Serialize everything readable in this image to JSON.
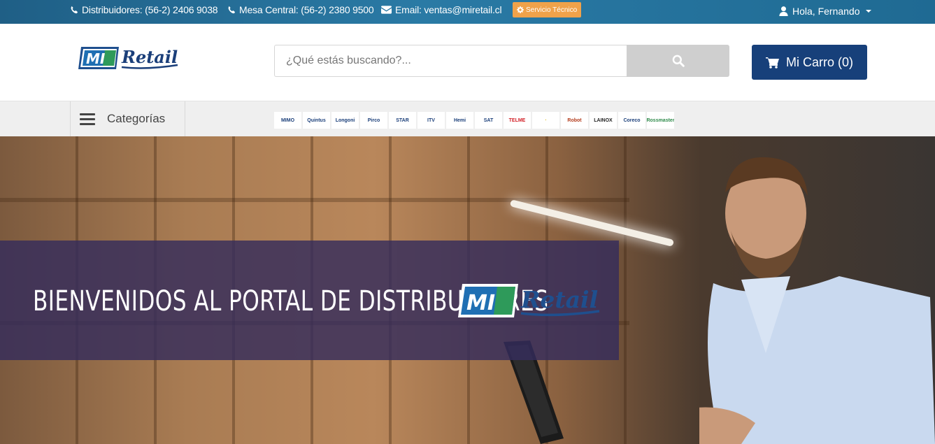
{
  "topbar": {
    "distribuidores": "Distribuidores: (56-2) 2406 9038",
    "mesa_central": "Mesa Central: (56-2) 2380 9500",
    "email": "Email: ventas@miretail.cl",
    "servicio_tecnico": "Servicio Técnico",
    "user_greeting": "Hola, Fernando"
  },
  "header": {
    "logo_text_mi": "MI",
    "logo_text_retail": "Retail",
    "search_placeholder": "¿Qué estás buscando?...",
    "cart_label": "Mi Carro (0)"
  },
  "nav": {
    "categories_label": "Categorías",
    "brands": [
      "MIMO",
      "Quintus",
      "Longoni",
      "Pirco",
      "STAR",
      "ITV",
      "Hemi",
      "SAT",
      "TELME",
      "·",
      "Robot",
      "LAINOX",
      "Coreco",
      "Rossmaster"
    ]
  },
  "hero": {
    "welcome_text": "BIENVENIDOS AL PORTAL DE DISTRIBUIDORES",
    "logo_text_mi": "MI",
    "logo_text_retail": "Retail"
  },
  "colors": {
    "topbar": "#1f6a93",
    "cart_button": "#17407a",
    "badge": "#f0a24a",
    "band": "#342c5c"
  }
}
